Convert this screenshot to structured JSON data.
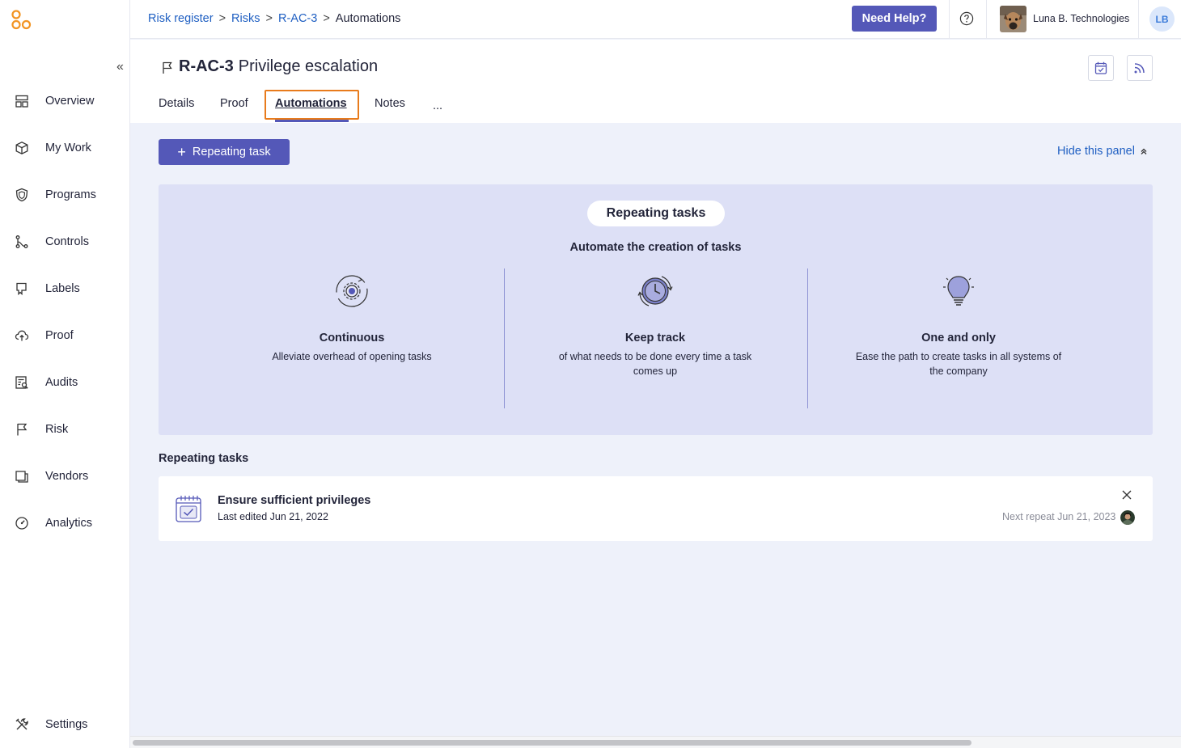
{
  "sidebar": {
    "collapse_icon": "double-chevron-left-icon",
    "items": [
      {
        "label": "Overview",
        "icon": "overview-icon"
      },
      {
        "label": "My Work",
        "icon": "cube-icon"
      },
      {
        "label": "Programs",
        "icon": "shield-icon"
      },
      {
        "label": "Controls",
        "icon": "controls-icon"
      },
      {
        "label": "Labels",
        "icon": "label-icon"
      },
      {
        "label": "Proof",
        "icon": "cloud-upload-icon"
      },
      {
        "label": "Audits",
        "icon": "audit-icon"
      },
      {
        "label": "Risk",
        "icon": "flag-icon"
      },
      {
        "label": "Vendors",
        "icon": "vendor-icon"
      },
      {
        "label": "Analytics",
        "icon": "gauge-icon"
      }
    ],
    "settings": {
      "label": "Settings",
      "icon": "tools-icon"
    }
  },
  "topbar": {
    "breadcrumbs": [
      "Risk register",
      "Risks",
      "R-AC-3",
      "Automations"
    ],
    "separator": ">",
    "help_button": "Need Help?",
    "org_name": "Luna B. Technologies",
    "user_initials": "LB"
  },
  "header": {
    "code": "R-AC-3",
    "name": "Privilege escalation",
    "tabs": [
      "Details",
      "Proof",
      "Automations",
      "Notes",
      "..."
    ],
    "active_tab": "Automations"
  },
  "actions": {
    "add_button": "Repeating task",
    "hide_panel": "Hide this panel"
  },
  "panel": {
    "pill": "Repeating tasks",
    "subtitle": "Automate the creation of tasks",
    "features": [
      {
        "title": "Continuous",
        "desc": "Alleviate overhead of opening tasks",
        "icon": "gear-cycle-icon"
      },
      {
        "title": "Keep track",
        "desc": "of what needs to be done every time a task comes up",
        "icon": "clock-cycle-icon"
      },
      {
        "title": "One and only",
        "desc": "Ease the path to create tasks in all systems of the company",
        "icon": "lightbulb-icon"
      }
    ]
  },
  "repeating": {
    "section_label": "Repeating tasks",
    "tasks": [
      {
        "title": "Ensure sufficient privileges",
        "edited": "Last edited Jun 21, 2022",
        "next": "Next repeat Jun 21, 2023"
      }
    ]
  },
  "colors": {
    "accent": "#5458b8",
    "link": "#1f5fc2",
    "highlight": "#e87b1c",
    "panel_bg": "#dde0f6"
  }
}
